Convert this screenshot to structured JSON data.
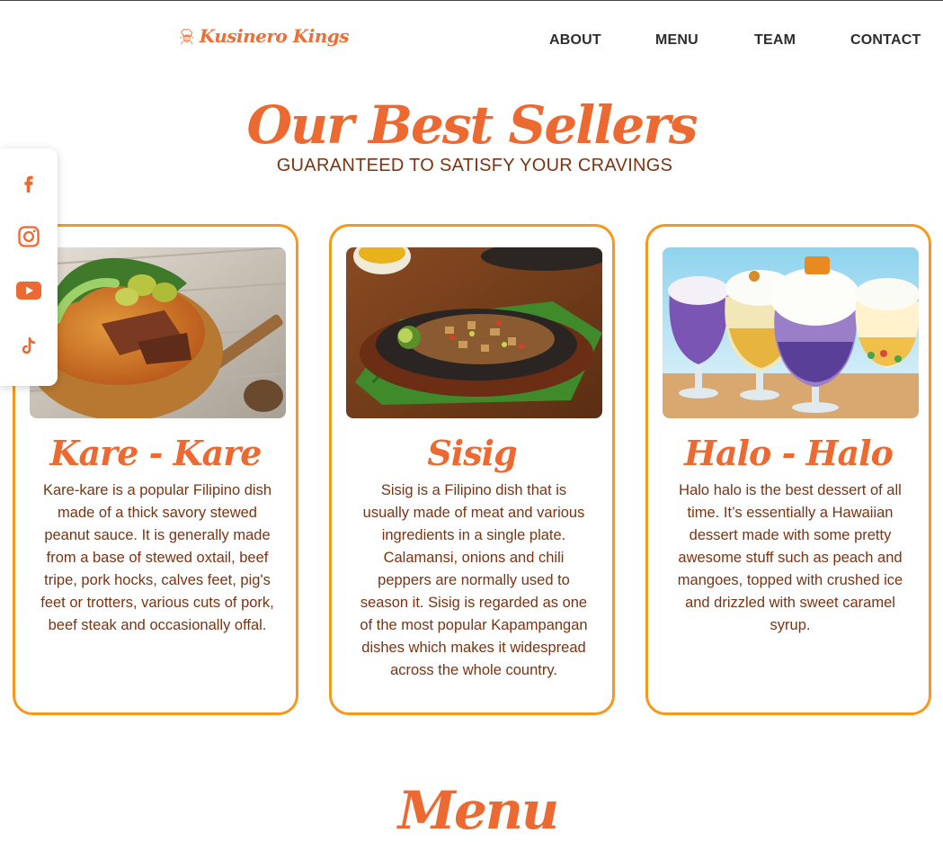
{
  "header": {
    "logo_text": "Kusinero Kings",
    "nav": [
      "ABOUT",
      "MENU",
      "TEAM",
      "CONTACT"
    ]
  },
  "hero": {
    "title": "Our Best Sellers",
    "subtitle": "GUARANTEED TO SATISFY YOUR CRAVINGS"
  },
  "social": [
    "facebook-icon",
    "instagram-icon",
    "youtube-icon",
    "tiktok-icon"
  ],
  "cards": [
    {
      "name": "Kare - Kare",
      "description": "Kare-kare is a popular Filipino dish made of a thick savory stewed peanut sauce. It is generally made from a base of stewed oxtail, beef tripe, pork hocks, calves feet, pig's feet or trotters, various cuts of pork, beef steak and occasionally offal."
    },
    {
      "name": "Sisig",
      "description": "Sisig is a Filipino dish that is usually made of meat and various ingredients in a single plate. Calamansi, onions and chili peppers are normally used to season it. Sisig is regarded as one of the most popular Kapampangan dishes which makes it widespread across the whole country."
    },
    {
      "name": "Halo - Halo",
      "description": "Halo halo is the best dessert of all time. It’s essentially a Hawaiian dessert made with some pretty awesome stuff such as peach and mangoes, topped with crushed ice and drizzled with sweet caramel syrup."
    }
  ],
  "next_section": {
    "title": "Menu"
  },
  "colors": {
    "accent": "#ec6a31",
    "card_border": "#f7971c",
    "body_text": "#7b3412",
    "nav_text": "#2d2d2d"
  }
}
